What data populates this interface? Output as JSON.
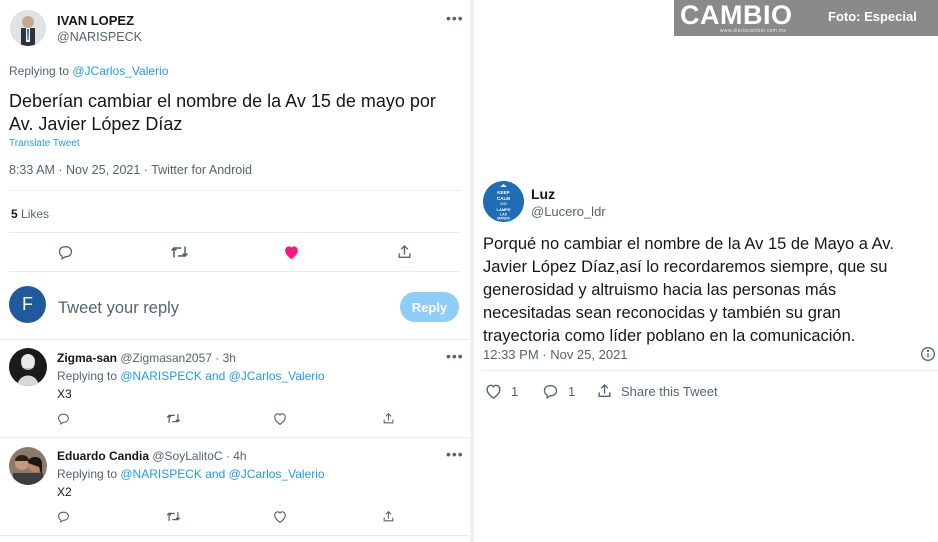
{
  "main_tweet": {
    "author_name": "IVAN LOPEZ",
    "author_handle": "@NARISPECK",
    "replying_prefix": "Replying to ",
    "replying_to": "@JCarlos_Valerio",
    "text_line1": "Deberían cambiar el nombre de la Av 15 de mayo por",
    "text_line2": "Av. Javier López Díaz",
    "translate": "Translate Tweet",
    "meta": "8:33 AM · Nov 25, 2021 · Twitter for Android",
    "likes_count": "5",
    "likes_label": "Likes",
    "liked": true,
    "like_color": "#f91880"
  },
  "reply_box": {
    "avatar_letter": "F",
    "avatar_color": "#1e5a9c",
    "placeholder": "Tweet your reply",
    "button_label": "Reply"
  },
  "replies": [
    {
      "name": "Zigma-san",
      "handle_time": "@Zigmasan2057 · 3h",
      "replying_prefix": "Replying to ",
      "replying_to": "@NARISPECK and @JCarlos_Valerio",
      "text": "X3"
    },
    {
      "name": "Eduardo Candia",
      "handle_time": "@SoyLalitoC · 4h",
      "replying_prefix": "Replying to ",
      "replying_to": "@NARISPECK and @JCarlos_Valerio",
      "text": "X2"
    }
  ],
  "watermark": {
    "logo": "CAMBIO",
    "url": "www.diariocambio.com.mx",
    "credit": "Foto: Especial",
    "bar_color": "#8a8a8a"
  },
  "quoted_tweet": {
    "author_name": "Luz",
    "author_handle": "@Lucero_ldr",
    "avatar_text": [
      "KEEP",
      "CALM",
      "AND",
      "LAMPE",
      "LAS",
      "MANOS"
    ],
    "avatar_color": "#1f6db5",
    "lines": [
      "Porqué no cambiar el nombre de la Av 15 de Mayo a Av.",
      "Javier López Díaz,así lo recordaremos siempre, que su",
      "generosidad y altruismo hacia las personas más",
      "necesitadas sean reconocidas y también su gran",
      "trayectoria como líder poblano en la comunicación."
    ],
    "meta": "12:33 PM · Nov 25, 2021",
    "like_count": "1",
    "reply_count": "1",
    "share_label": "Share this Tweet"
  },
  "icons": [
    "reply-icon",
    "retweet-icon",
    "heart-icon",
    "share-icon",
    "info-icon",
    "more-icon"
  ]
}
